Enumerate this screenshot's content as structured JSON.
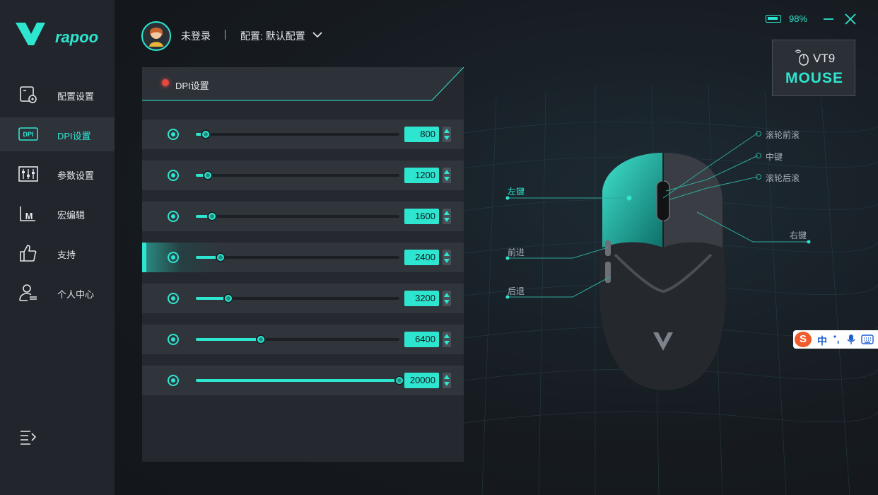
{
  "brand": {
    "logo_text": "rapoo"
  },
  "sidebar": {
    "items": [
      {
        "label": "配置设置",
        "icon": "config-icon"
      },
      {
        "label": "DPI设置",
        "icon": "dpi-icon",
        "active": true
      },
      {
        "label": "参数设置",
        "icon": "sliders-icon"
      },
      {
        "label": "宏编辑",
        "icon": "macro-icon"
      },
      {
        "label": "支持",
        "icon": "thumbs-up-icon"
      },
      {
        "label": "个人中心",
        "icon": "user-center-icon"
      }
    ],
    "collapse_icon": "menu-collapse-icon"
  },
  "header": {
    "login_status": "未登录",
    "profile_label": "配置: 默认配置"
  },
  "window": {
    "battery": "98%",
    "battery_level": 0.98
  },
  "device": {
    "name": "VT9",
    "type": "MOUSE"
  },
  "dpi_panel": {
    "title": "DPI设置",
    "max_dpi": 20000,
    "rows": [
      {
        "value": "800",
        "dpi": 800,
        "active": false
      },
      {
        "value": "1200",
        "dpi": 1200,
        "active": false
      },
      {
        "value": "1600",
        "dpi": 1600,
        "active": false
      },
      {
        "value": "2400",
        "dpi": 2400,
        "active": true
      },
      {
        "value": "3200",
        "dpi": 3200,
        "active": false
      },
      {
        "value": "6400",
        "dpi": 6400,
        "active": false
      },
      {
        "value": "20000",
        "dpi": 20000,
        "active": false
      }
    ]
  },
  "mouse_labels": {
    "left": "左键",
    "forward": "前进",
    "back": "后退",
    "scroll_forward": "滚轮前滚",
    "middle": "中键",
    "scroll_back": "滚轮后滚",
    "right": "右键"
  },
  "ime": {
    "logo": "S",
    "mode": "中"
  },
  "colors": {
    "accent": "#2ee6d0",
    "background": "#14171b",
    "sidebar": "#22262c",
    "panel": "#25292f",
    "indicator": "#e8473f"
  }
}
